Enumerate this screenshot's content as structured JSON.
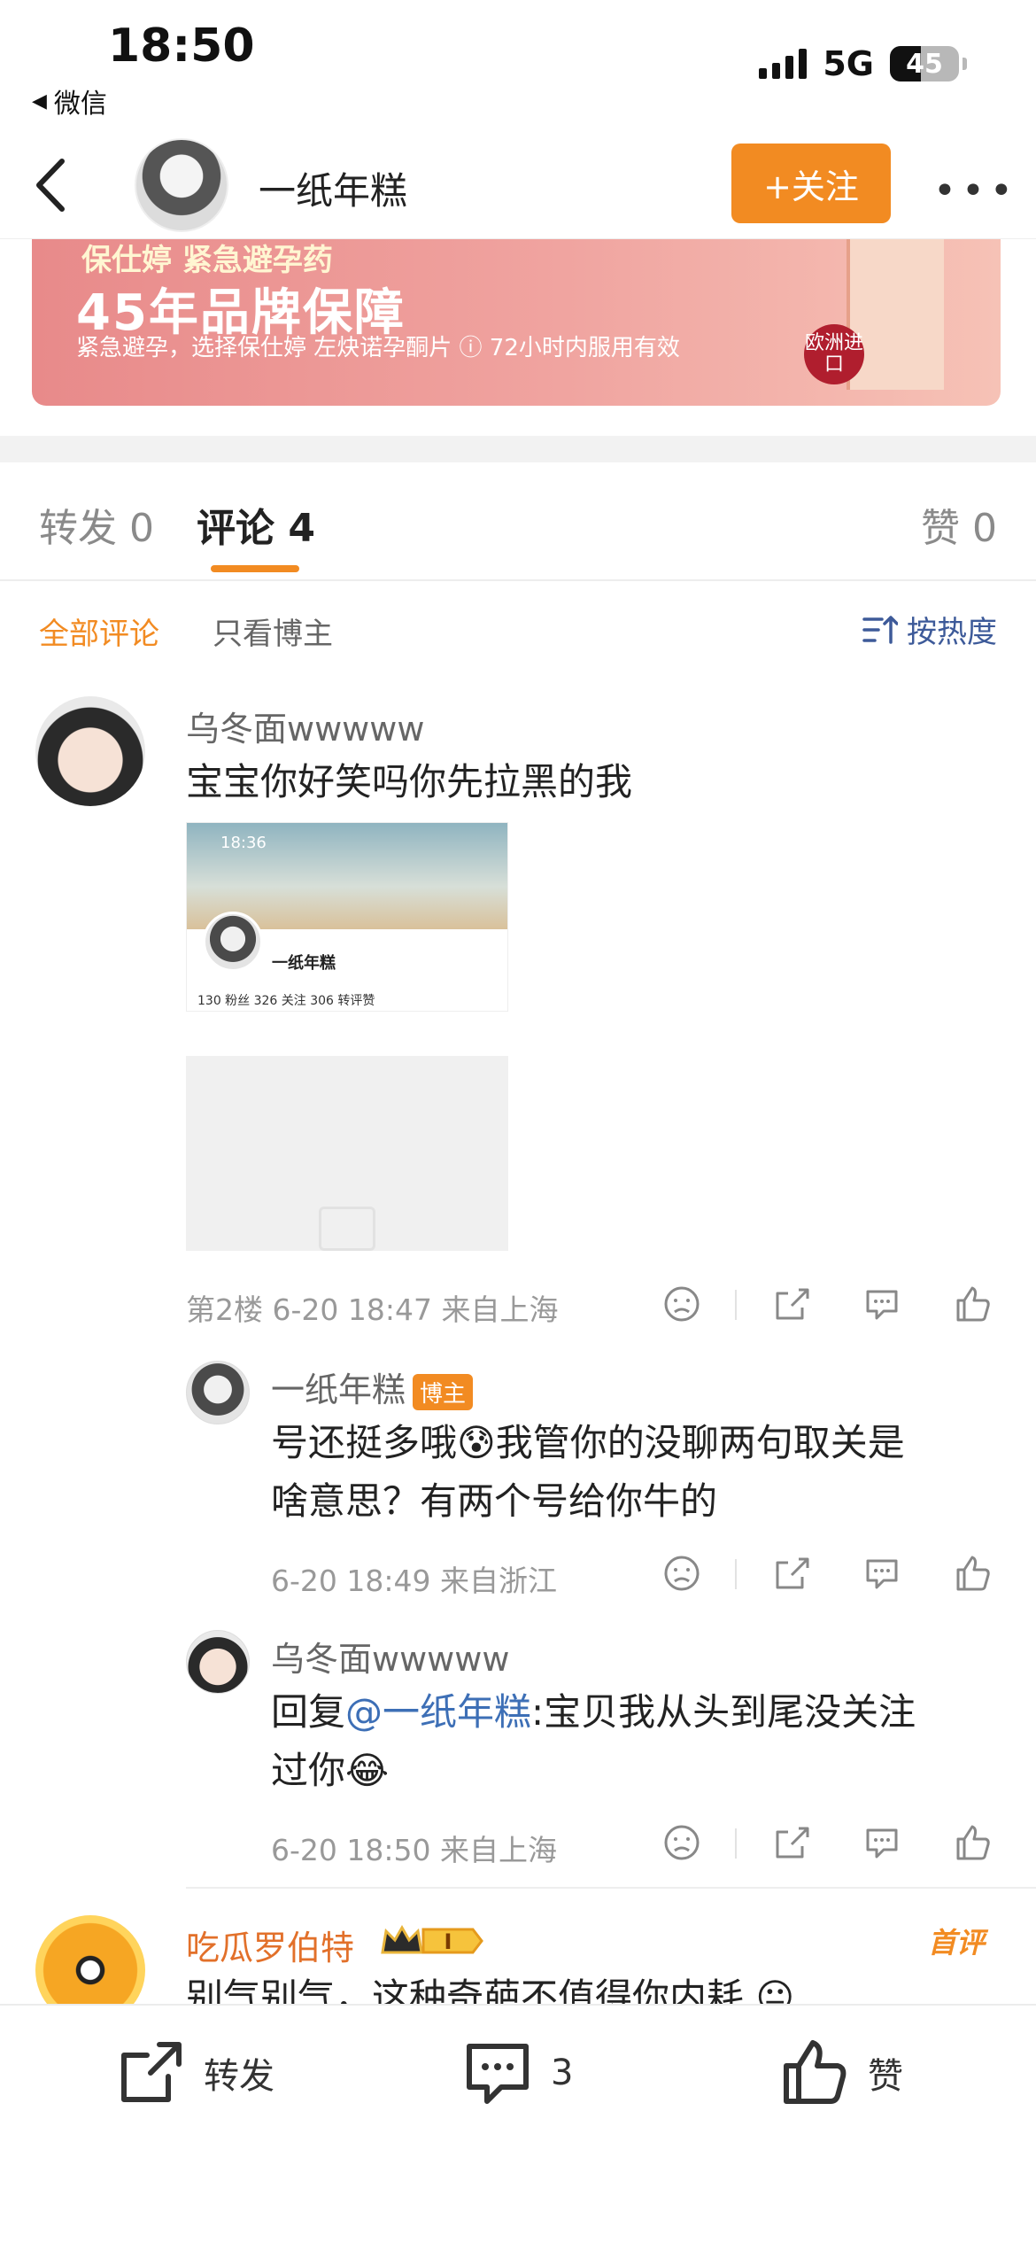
{
  "status_bar": {
    "time": "18:50",
    "back_app": "微信",
    "network": "5G",
    "battery": "45"
  },
  "header": {
    "name": "一纸年糕",
    "follow_label": "+关注",
    "more": "•••"
  },
  "ad": {
    "line1": "保仕婷  紧急避孕药",
    "line2": "45年品牌保障",
    "line3": "紧急避孕，选择保仕婷 左炔诺孕酮片  ⓘ 72小时内服用有效",
    "badge": "欧洲进口"
  },
  "tabs": {
    "repost": "转发 0",
    "comment": "评论 4",
    "like": "赞 0"
  },
  "filters": {
    "all": "全部评论",
    "host_only": "只看博主",
    "sort": "按热度"
  },
  "comments": [
    {
      "user": "乌冬面wwwww",
      "text": "宝宝你好笑吗你先拉黑的我",
      "screenshot": {
        "time": "18:36",
        "name": "一纸年糕",
        "stats": "130 粉丝   326 关注   306 转评赞"
      },
      "meta": "第2楼 6-20 18:47 来自上海",
      "replies": [
        {
          "user": "一纸年糕",
          "tag": "博主",
          "text_line1": "号还挺多哦😰我管你的没聊两句取关是",
          "text_line2": "啥意思？有两个号给你牛的",
          "meta": "6-20 18:49 来自浙江"
        },
        {
          "user": "乌冬面wwwww",
          "reply_prefix": "回复",
          "mention": "@一纸年糕",
          "text_line1_rest": ":宝贝我从头到尾没关注",
          "text_line2": "过你😂",
          "meta": "6-20 18:50 来自上海"
        }
      ]
    },
    {
      "user": "吃瓜罗伯特",
      "badge": "I",
      "first_tag": "首评",
      "text": "别气别气，这种奇葩不值得你内耗 😐"
    }
  ],
  "bottom_bar": {
    "repost": "转发",
    "comment_count": "3",
    "like": "赞"
  },
  "colors": {
    "accent": "#f28b22",
    "link": "#3d6fb6"
  }
}
